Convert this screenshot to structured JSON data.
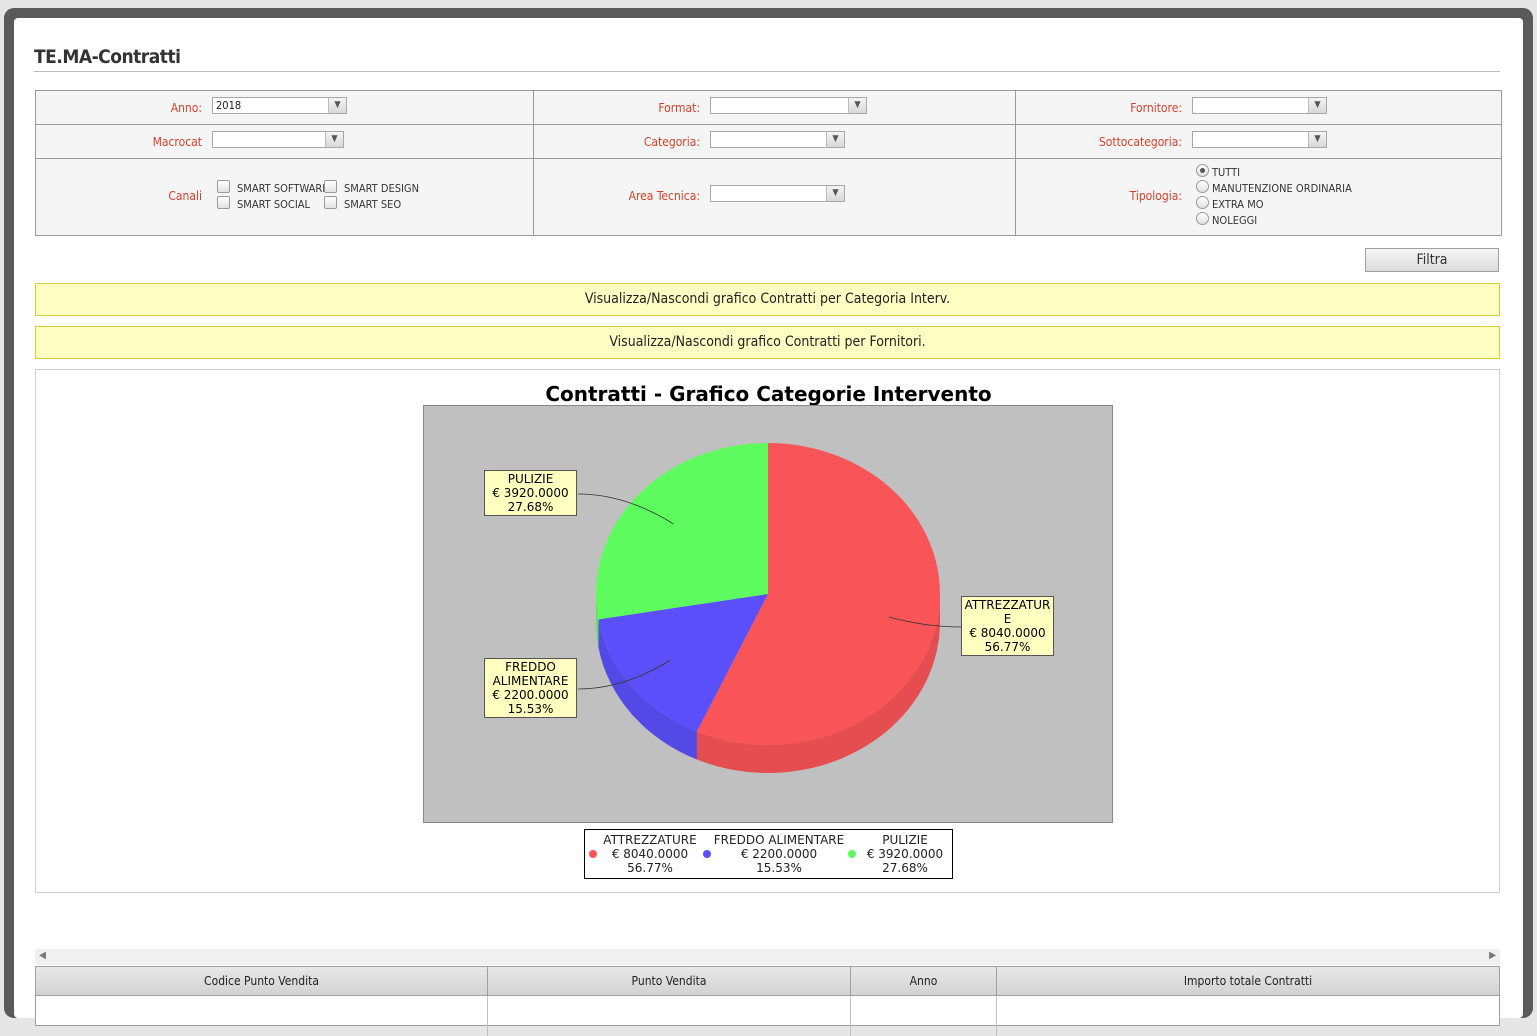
{
  "page": {
    "title": "TE.MA-Contratti"
  },
  "filters": {
    "anno": {
      "label": "Anno:",
      "value": "2018"
    },
    "format": {
      "label": "Format:",
      "value": ""
    },
    "fornitore": {
      "label": "Fornitore:",
      "value": ""
    },
    "macrocat": {
      "label": "Macrocat",
      "value": ""
    },
    "categoria": {
      "label": "Categoria:",
      "value": ""
    },
    "sottocategoria": {
      "label": "Sottocategoria:",
      "value": ""
    },
    "canali": {
      "label": "Canali",
      "options": [
        "SMART SOFTWARE",
        "SMART DESIGN",
        "SMART SOCIAL",
        "SMART SEO"
      ]
    },
    "area_tecnica": {
      "label": "Area Tecnica:",
      "value": ""
    },
    "tipologia": {
      "label": "Tipologia:",
      "options": [
        "TUTTI",
        "MANUTENZIONE ORDINARIA",
        "EXTRA MO",
        "NOLEGGI"
      ],
      "selected": "TUTTI"
    },
    "filtra_label": "Filtra"
  },
  "toggles": {
    "categoria": "Visualizza/Nascondi grafico Contratti per Categoria Interv.",
    "fornitori": "Visualizza/Nascondi grafico Contratti per Fornitori."
  },
  "chart_data": {
    "type": "pie",
    "title": "Contratti - Grafico Categorie Intervento",
    "categories": [
      "ATTREZZATURE",
      "FREDDO ALIMENTARE",
      "PULIZIE"
    ],
    "values": [
      8040.0,
      2200.0,
      3920.0
    ],
    "value_labels": [
      "€ 8040.0000",
      "€ 2200.0000",
      "€ 3920.0000"
    ],
    "percent_labels": [
      "56.77%",
      "15.53%",
      "27.68%"
    ],
    "callout_labels": [
      "ATTREZZATUR\nE",
      "FREDDO\nALIMENTARE",
      "PULIZIE"
    ],
    "colors": [
      "#f95457",
      "#5a4ffb",
      "#5efb5e"
    ],
    "legend": "bottom"
  },
  "table": {
    "columns": [
      "Codice Punto Vendita",
      "Punto Vendita",
      "Anno",
      "Importo totale Contratti"
    ]
  },
  "colors": {
    "label_red": "#d8412c",
    "toggle_bg": "#ffffc4",
    "plot_bg": "#c0c0c0"
  }
}
